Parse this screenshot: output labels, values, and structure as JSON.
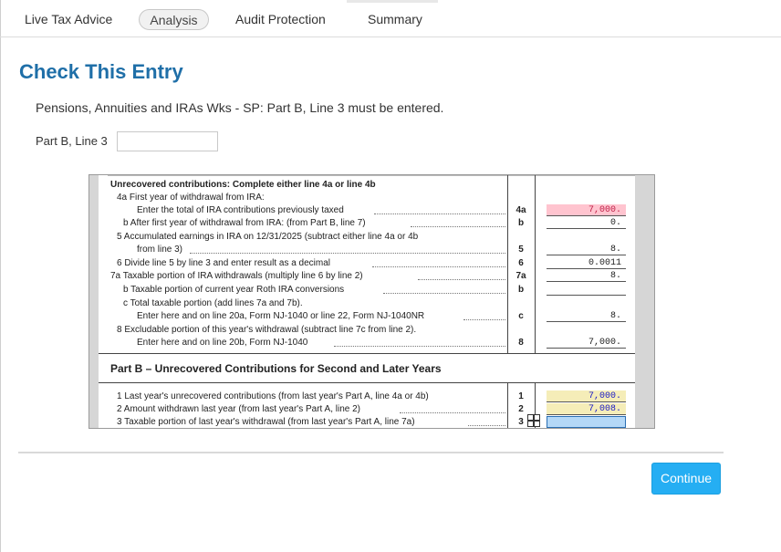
{
  "tabs": [
    {
      "label": "Live Tax Advice"
    },
    {
      "label": "Analysis"
    },
    {
      "label": "Audit Protection"
    },
    {
      "label": "Summary"
    }
  ],
  "page_title": "Check This Entry",
  "message": "Pensions, Annuities and IRAs Wks - SP: Part B, Line 3 must be entered.",
  "field": {
    "label": "Part B, Line 3",
    "value": ""
  },
  "worksheet": {
    "header": "Unrecovered contributions: Complete either line 4a or line 4b",
    "rows": [
      {
        "text": "4a  First year of withdrawal from IRA:",
        "label": "",
        "amount": ""
      },
      {
        "text": "Enter the total of IRA contributions previously taxed",
        "label": "4a",
        "amount": "7,000."
      },
      {
        "text": "b  After first year of withdrawal from IRA: (from Part B, line 7)",
        "label": "b",
        "amount": "0."
      },
      {
        "text": "5  Accumulated earnings in IRA on 12/31/2025 (subtract either line 4a or 4b",
        "label": "",
        "amount": ""
      },
      {
        "text": "from line 3)",
        "label": "5",
        "amount": "8."
      },
      {
        "text": "6  Divide line 5 by line 3 and enter result as a decimal",
        "label": "6",
        "amount": "0.0011"
      },
      {
        "text": "7a  Taxable portion of IRA withdrawals (multiply line 6 by line 2)",
        "label": "7a",
        "amount": "8."
      },
      {
        "text": "b  Taxable portion of current year Roth IRA conversions",
        "label": "b",
        "amount": ""
      },
      {
        "text": "c  Total taxable portion (add lines 7a and 7b).",
        "label": "",
        "amount": ""
      },
      {
        "text": "Enter here and on line 20a, Form NJ-1040 or line 22, Form NJ-1040NR",
        "label": "c",
        "amount": "8."
      },
      {
        "text": "8  Excludable portion of this year's withdrawal (subtract line 7c from line 2).",
        "label": "",
        "amount": ""
      },
      {
        "text": "Enter here and on line 20b, Form NJ-1040",
        "label": "8",
        "amount": "7,000."
      }
    ],
    "part_b_header": "Part B – Unrecovered Contributions for Second and Later Years",
    "part_b_rows": [
      {
        "text": "1  Last year's unrecovered contributions (from last year's Part A, line 4a or 4b)",
        "label": "1",
        "amount": "7,000."
      },
      {
        "text": "2  Amount withdrawn last year (from last year's Part A, line 2)",
        "label": "2",
        "amount": "7,008."
      },
      {
        "text": "3  Taxable portion of last year's withdrawal (from last year's Part A, line 7a)",
        "label": "3",
        "amount": ""
      }
    ]
  },
  "continue_label": "Continue",
  "colors": {
    "title": "#1f6fa8",
    "button": "#25aef3",
    "error_fill": "#ffc4cf",
    "import_fill": "#f5edb8",
    "active_field": "#b4d8f7",
    "blue_value": "#1a1ac8"
  }
}
